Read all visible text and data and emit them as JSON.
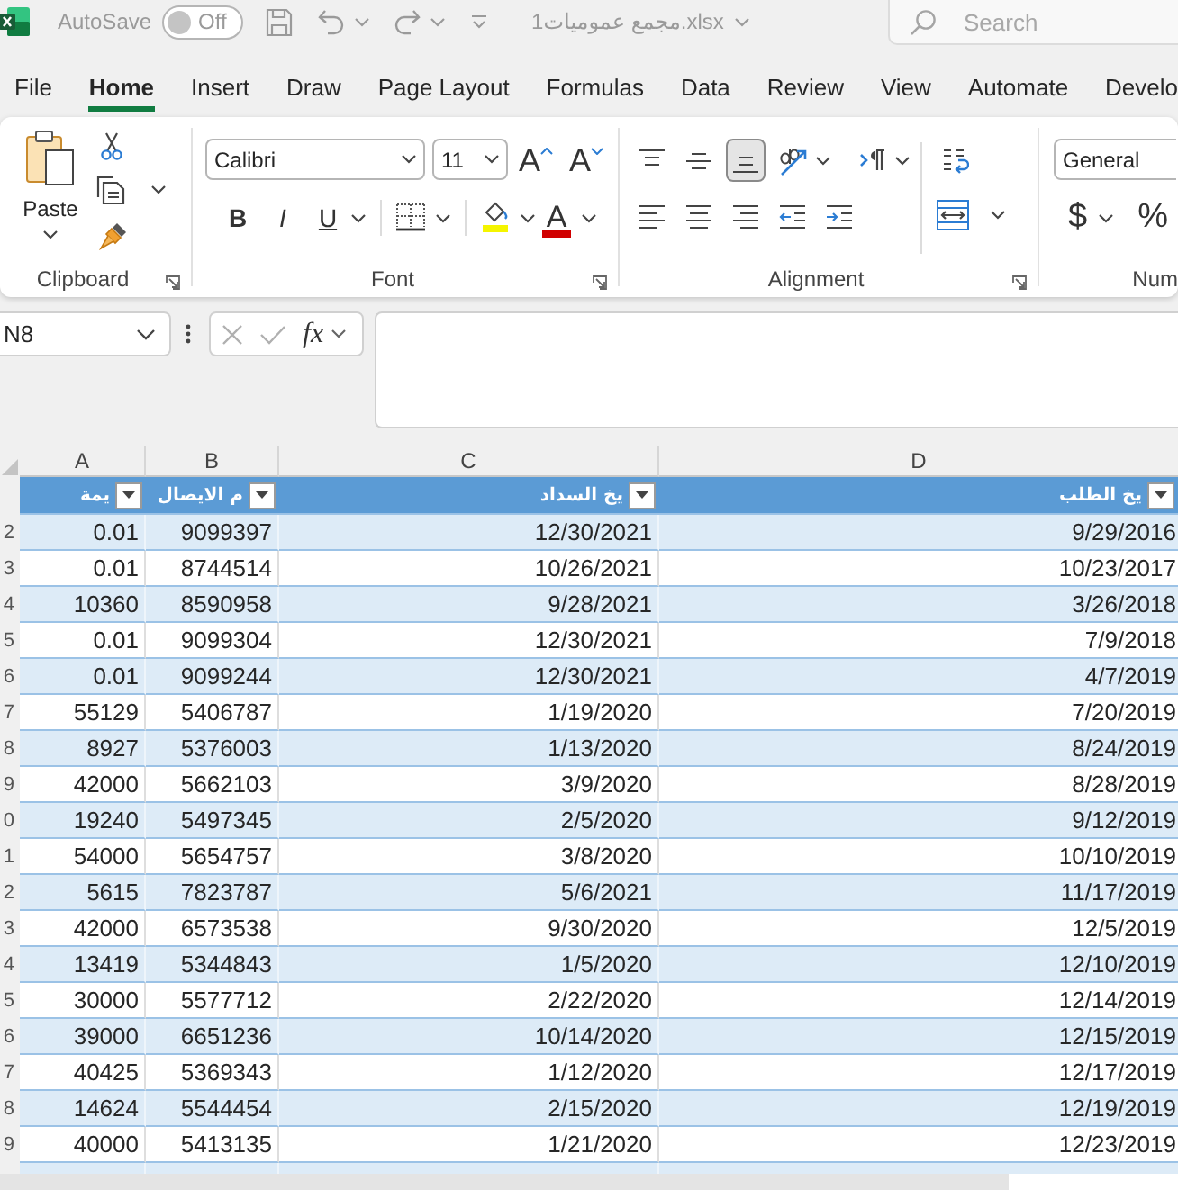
{
  "title_bar": {
    "autosave_label": "AutoSave",
    "autosave_toggle": {
      "label": "Off",
      "on": false
    },
    "file_name": "مجمع عموميات1.xlsx",
    "search": {
      "placeholder": "Search"
    }
  },
  "ribbon_tabs": [
    {
      "label": "File",
      "selected": false
    },
    {
      "label": "Home",
      "selected": true
    },
    {
      "label": "Insert",
      "selected": false
    },
    {
      "label": "Draw",
      "selected": false
    },
    {
      "label": "Page Layout",
      "selected": false
    },
    {
      "label": "Formulas",
      "selected": false
    },
    {
      "label": "Data",
      "selected": false
    },
    {
      "label": "Review",
      "selected": false
    },
    {
      "label": "View",
      "selected": false
    },
    {
      "label": "Automate",
      "selected": false
    },
    {
      "label": "Develo",
      "selected": false
    }
  ],
  "ribbon": {
    "clipboard": {
      "label": "Clipboard",
      "paste": "Paste"
    },
    "font": {
      "label": "Font",
      "font_name": "Calibri",
      "font_size": "11",
      "grow_font": "A",
      "shrink_font": "A",
      "bold": "B",
      "italic": "I",
      "underline": "U",
      "font_color": "A"
    },
    "alignment": {
      "label": "Alignment",
      "vertical": [
        {
          "kind": "top",
          "selected": false
        },
        {
          "kind": "middle",
          "selected": false
        },
        {
          "kind": "bottom",
          "selected": true
        }
      ]
    },
    "number": {
      "label": "Num",
      "format": "General",
      "currency": "$",
      "percent": "%"
    }
  },
  "formula_bar": {
    "name_box": "N8",
    "function_button": "fx"
  },
  "sheet": {
    "columns": [
      {
        "letter": "A",
        "header": "يمة"
      },
      {
        "letter": "B",
        "header": "م الايصال"
      },
      {
        "letter": "C",
        "header": "يخ السداد"
      },
      {
        "letter": "D",
        "header": "يخ الطلب"
      }
    ],
    "rows": [
      {
        "row_number": "2",
        "cells": [
          "0.01",
          "9099397",
          "12/30/2021",
          "9/29/2016"
        ]
      },
      {
        "row_number": "3",
        "cells": [
          "0.01",
          "8744514",
          "10/26/2021",
          "10/23/2017"
        ]
      },
      {
        "row_number": "4",
        "cells": [
          "10360",
          "8590958",
          "9/28/2021",
          "3/26/2018"
        ]
      },
      {
        "row_number": "5",
        "cells": [
          "0.01",
          "9099304",
          "12/30/2021",
          "7/9/2018"
        ]
      },
      {
        "row_number": "6",
        "cells": [
          "0.01",
          "9099244",
          "12/30/2021",
          "4/7/2019"
        ]
      },
      {
        "row_number": "7",
        "cells": [
          "55129",
          "5406787",
          "1/19/2020",
          "7/20/2019"
        ]
      },
      {
        "row_number": "8",
        "cells": [
          "8927",
          "5376003",
          "1/13/2020",
          "8/24/2019"
        ]
      },
      {
        "row_number": "9",
        "cells": [
          "42000",
          "5662103",
          "3/9/2020",
          "8/28/2019"
        ]
      },
      {
        "row_number": "0",
        "cells": [
          "19240",
          "5497345",
          "2/5/2020",
          "9/12/2019"
        ]
      },
      {
        "row_number": "1",
        "cells": [
          "54000",
          "5654757",
          "3/8/2020",
          "10/10/2019"
        ]
      },
      {
        "row_number": "2",
        "cells": [
          "5615",
          "7823787",
          "5/6/2021",
          "11/17/2019"
        ]
      },
      {
        "row_number": "3",
        "cells": [
          "42000",
          "6573538",
          "9/30/2020",
          "12/5/2019"
        ]
      },
      {
        "row_number": "4",
        "cells": [
          "13419",
          "5344843",
          "1/5/2020",
          "12/10/2019"
        ]
      },
      {
        "row_number": "5",
        "cells": [
          "30000",
          "5577712",
          "2/22/2020",
          "12/14/2019"
        ]
      },
      {
        "row_number": "6",
        "cells": [
          "39000",
          "6651236",
          "10/14/2020",
          "12/15/2019"
        ]
      },
      {
        "row_number": "7",
        "cells": [
          "40425",
          "5369343",
          "1/12/2020",
          "12/17/2019"
        ]
      },
      {
        "row_number": "8",
        "cells": [
          "14624",
          "5544454",
          "2/15/2020",
          "12/19/2019"
        ]
      },
      {
        "row_number": "9",
        "cells": [
          "40000",
          "5413135",
          "1/21/2020",
          "12/23/2019"
        ]
      }
    ]
  }
}
